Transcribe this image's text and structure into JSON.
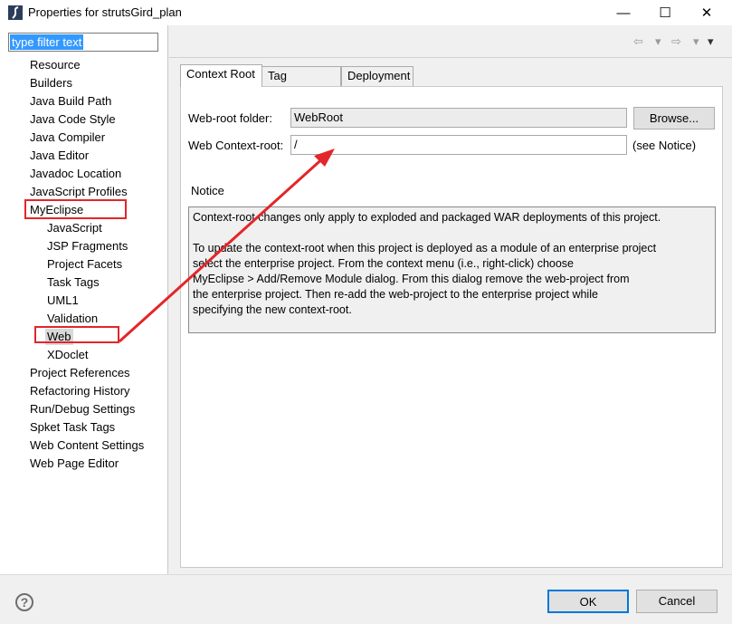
{
  "window": {
    "title": "Properties for strutsGird_plan",
    "minimize_glyph": "—",
    "maximize_glyph": "☐",
    "close_glyph": "✕"
  },
  "filter": {
    "value": "type filter text"
  },
  "tree": {
    "items": [
      {
        "label": "Resource"
      },
      {
        "label": "Builders"
      },
      {
        "label": "Java Build Path"
      },
      {
        "label": "Java Code Style"
      },
      {
        "label": "Java Compiler"
      },
      {
        "label": "Java Editor"
      },
      {
        "label": "Javadoc Location"
      },
      {
        "label": "JavaScript Profiles"
      },
      {
        "label": "MyEclipse"
      },
      {
        "label": "JavaScript"
      },
      {
        "label": "JSP Fragments"
      },
      {
        "label": "Project Facets"
      },
      {
        "label": "Task Tags"
      },
      {
        "label": "UML1"
      },
      {
        "label": "Validation"
      },
      {
        "label": "Web"
      },
      {
        "label": "XDoclet"
      },
      {
        "label": "Project References"
      },
      {
        "label": "Refactoring History"
      },
      {
        "label": "Run/Debug Settings"
      },
      {
        "label": "Spket Task Tags"
      },
      {
        "label": "Web Content Settings"
      },
      {
        "label": "Web Page Editor"
      }
    ],
    "selected": "Web"
  },
  "nav": {
    "back": "⇦",
    "back_menu": "▾",
    "forward": "⇨",
    "forward_menu": "▾",
    "view_menu": "▾"
  },
  "tabs": [
    {
      "label": "Context Root",
      "active": true
    },
    {
      "label": "Tag Libraries",
      "active": false
    },
    {
      "label": "Deployment",
      "active": false
    }
  ],
  "form": {
    "web_root_label": "Web-root folder:",
    "web_root_value": "WebRoot",
    "browse_label": "Browse...",
    "context_root_label": "Web Context-root:",
    "context_root_value": "/",
    "see_notice": "(see Notice)"
  },
  "notice": {
    "heading": "Notice",
    "paragraph1": "Context-root changes only apply to exploded and packaged WAR deployments of this project.",
    "paragraph2": "To update the context-root when this project is deployed as a module of an enterprise project\nselect the enterprise project. From the context menu (i.e., right-click) choose\nMyEclipse > Add/Remove Module dialog. From this dialog remove the web-project from\nthe enterprise project. Then re-add the web-project to the enterprise project while\nspecifying the new context-root."
  },
  "footer": {
    "help_glyph": "?",
    "ok_label": "OK",
    "cancel_label": "Cancel"
  },
  "colors": {
    "highlight": "#e3262a",
    "selection": "#3399ff",
    "ok_border": "#0078d7"
  }
}
